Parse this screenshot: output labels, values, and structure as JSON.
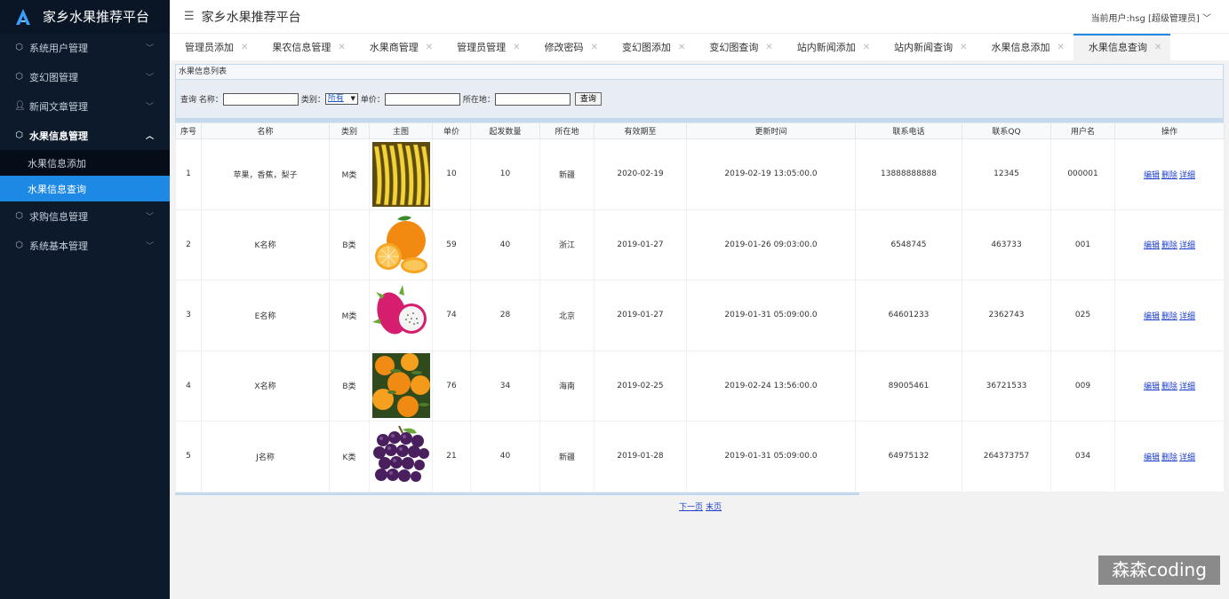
{
  "app": {
    "name": "家乡水果推荐平台",
    "header_title": "家乡水果推荐平台",
    "user_info": "当前用户:hsg [超级管理员]"
  },
  "sidebar": {
    "items": [
      {
        "label": "系统用户管理",
        "icon": "cube-icon"
      },
      {
        "label": "变幻图管理",
        "icon": "cube-icon"
      },
      {
        "label": "新闻文章管理",
        "icon": "user-icon"
      },
      {
        "label": "水果信息管理",
        "icon": "cube-icon"
      },
      {
        "label": "求购信息管理",
        "icon": "cube-icon"
      },
      {
        "label": "系统基本管理",
        "icon": "cube-icon"
      }
    ],
    "submenu": [
      {
        "label": "水果信息添加"
      },
      {
        "label": "水果信息查询"
      }
    ]
  },
  "tabs": [
    {
      "label": "管理员添加"
    },
    {
      "label": "果农信息管理"
    },
    {
      "label": "水果商管理"
    },
    {
      "label": "管理员管理"
    },
    {
      "label": "修改密码"
    },
    {
      "label": "变幻图添加"
    },
    {
      "label": "变幻图查询"
    },
    {
      "label": "站内新闻添加"
    },
    {
      "label": "站内新闻查询"
    },
    {
      "label": "水果信息添加"
    },
    {
      "label": "水果信息查询"
    }
  ],
  "panel": {
    "title": "水果信息列表",
    "search": {
      "prefix": "查询 名称：",
      "category_label": "类别：",
      "category_value": "所有",
      "price_label": "单价：",
      "location_label": "所在地：",
      "button": "查询"
    }
  },
  "table": {
    "headers": [
      "序号",
      "名称",
      "类别",
      "主图",
      "单价",
      "起发数量",
      "所在地",
      "有效期至",
      "更新时间",
      "联系电话",
      "联系QQ",
      "用户名",
      "操作"
    ],
    "rows": [
      {
        "no": "1",
        "name": "苹果，香蕉，梨子",
        "category": "M类",
        "image": "banana",
        "price": "10",
        "min_qty": "10",
        "location": "新疆",
        "valid_until": "2020-02-19",
        "updated": "2019-02-19 13:05:00.0",
        "phone": "13888888888",
        "qq": "12345",
        "user": "000001"
      },
      {
        "no": "2",
        "name": "K名称",
        "category": "B类",
        "image": "orange",
        "price": "59",
        "min_qty": "40",
        "location": "浙江",
        "valid_until": "2019-01-27",
        "updated": "2019-01-26 09:03:00.0",
        "phone": "6548745",
        "qq": "463733",
        "user": "001"
      },
      {
        "no": "3",
        "name": "E名称",
        "category": "M类",
        "image": "dragonfruit",
        "price": "74",
        "min_qty": "28",
        "location": "北京",
        "valid_until": "2019-01-27",
        "updated": "2019-01-31 05:09:00.0",
        "phone": "64601233",
        "qq": "2362743",
        "user": "025"
      },
      {
        "no": "4",
        "name": "X名称",
        "category": "B类",
        "image": "tangerine",
        "price": "76",
        "min_qty": "34",
        "location": "海南",
        "valid_until": "2019-02-25",
        "updated": "2019-02-24 13:56:00.0",
        "phone": "89005461",
        "qq": "36721533",
        "user": "009"
      },
      {
        "no": "5",
        "name": "J名称",
        "category": "K类",
        "image": "grape",
        "price": "21",
        "min_qty": "40",
        "location": "新疆",
        "valid_until": "2019-01-28",
        "updated": "2019-01-31 05:09:00.0",
        "phone": "64975132",
        "qq": "264373757",
        "user": "034"
      }
    ],
    "actions": {
      "edit": "编辑",
      "delete": "删除",
      "detail": "详细"
    }
  },
  "pager": {
    "next": "下一页",
    "last": "末页"
  },
  "watermark": "森森coding",
  "colors": {
    "sidebar_bg": "#0c1a2c",
    "accent": "#1e88e5",
    "link": "#1e3fc9"
  }
}
